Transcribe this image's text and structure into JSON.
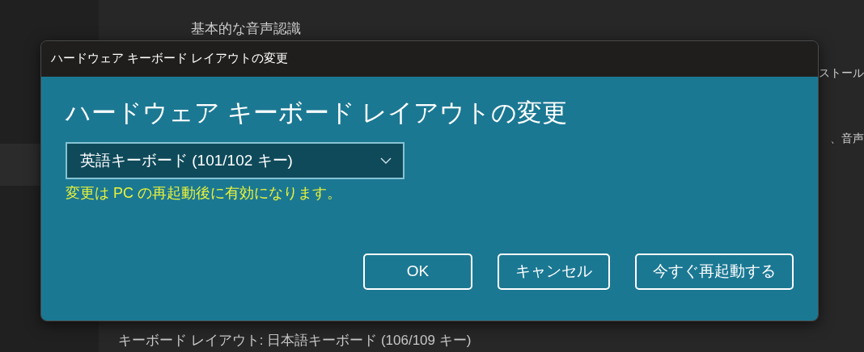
{
  "background": {
    "section_heading": "基本的な音声認識",
    "right_texts": [
      {
        "text": "ストール"
      },
      {
        "text": "、音声"
      }
    ],
    "footer_text": "キーボード レイアウト: 日本語キーボード (106/109 キー)"
  },
  "dialog": {
    "title": "ハードウェア キーボード レイアウトの変更",
    "heading": "ハードウェア キーボード レイアウトの変更",
    "dropdown": {
      "value": "英語キーボード (101/102 キー)"
    },
    "note": "変更は PC の再起動後に有効になります。",
    "buttons": [
      {
        "label": "OK"
      },
      {
        "label": "キャンセル"
      },
      {
        "label": "今すぐ再起動する"
      }
    ]
  }
}
